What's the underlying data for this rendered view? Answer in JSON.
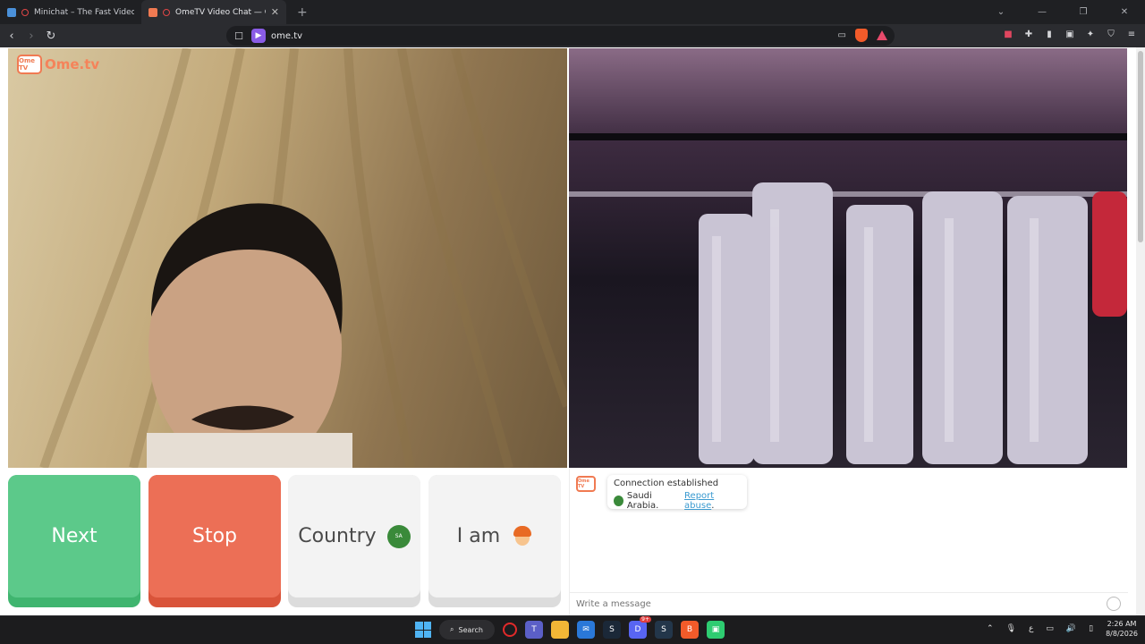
{
  "browser": {
    "tabs": [
      {
        "title": "Minichat – The Fast Video Chat",
        "active": false
      },
      {
        "title": "OmeTV Video Chat — Omeg",
        "active": true
      }
    ],
    "new_tab_symbol": "+",
    "url": "ome.tv",
    "window_controls": [
      "chevron-down",
      "minimize",
      "restore",
      "close"
    ]
  },
  "site": {
    "logo_text": "Ome.tv",
    "logo_badge": "Ome TV"
  },
  "controls": {
    "next_label": "Next",
    "stop_label": "Stop",
    "country_label": "Country",
    "country_badge": "SA",
    "iam_label": "I am"
  },
  "chat": {
    "status": "Connection established",
    "country": "Saudi Arabia.",
    "report_label": "Report abuse",
    "report_trailing": ".",
    "message_placeholder": "Write a message"
  },
  "taskbar": {
    "search_label": "Search",
    "discord_badge": "9+",
    "language": "ع",
    "time": "2:26 AM",
    "date": "8/8/2026"
  },
  "colors": {
    "next": "#5cc98a",
    "stop": "#ec6f56",
    "brand": "#f07a52",
    "link": "#3a9ad0"
  }
}
